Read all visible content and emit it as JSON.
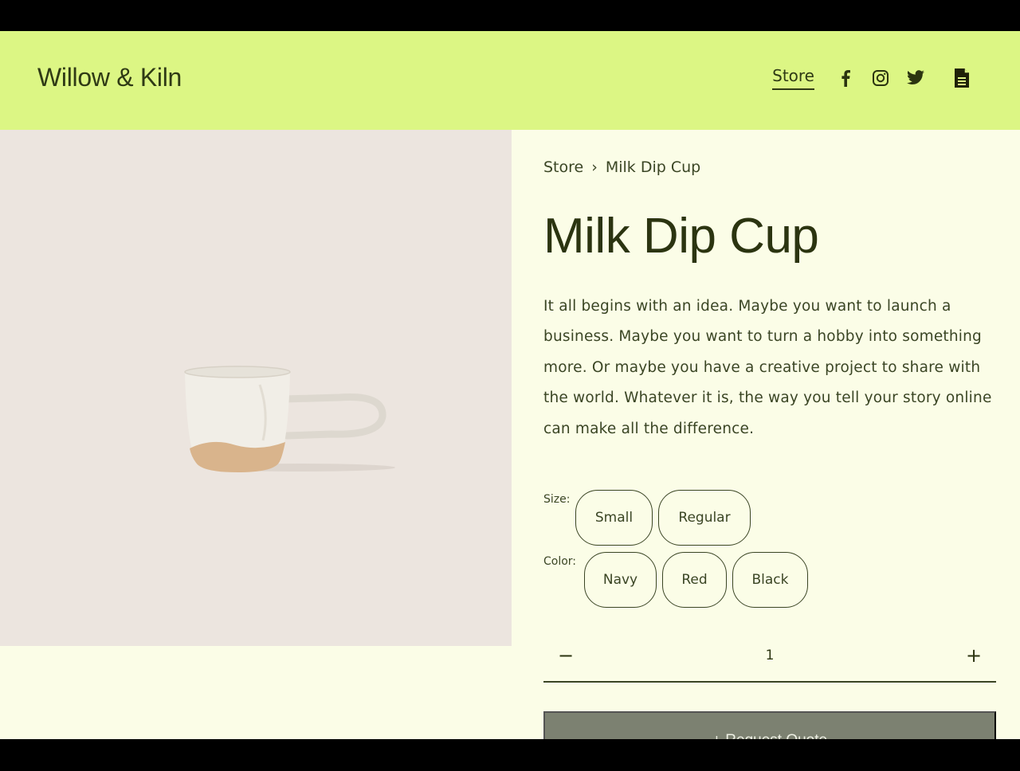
{
  "header": {
    "brand": "Willow & Kiln",
    "nav_store": "Store",
    "social_icons": [
      "facebook-icon",
      "instagram-icon",
      "twitter-icon"
    ],
    "doc_icon": "document-icon",
    "background": "#dcf684"
  },
  "breadcrumb": {
    "parent": "Store",
    "separator": "›",
    "current": "Milk Dip Cup"
  },
  "product": {
    "title": "Milk Dip Cup",
    "description": "It all begins with an idea. Maybe you want to launch a business. Maybe you want to turn a hobby into something more. Or maybe you have a creative project to share with the world. Whatever it is, the way you tell your story online can make all the difference.",
    "size_label": "Size:",
    "sizes": [
      "Small",
      "Regular"
    ],
    "color_label": "Color:",
    "colors": [
      "Navy",
      "Red",
      "Black"
    ]
  },
  "quantity": {
    "minus": "−",
    "value": "1",
    "plus": "+"
  },
  "actions": {
    "request_quote": "+ Request Quote"
  },
  "colors": {
    "page_bg": "#fbfde7",
    "image_bg": "#ece5df",
    "text": "#2b3410",
    "button_bg": "#7c8171"
  }
}
